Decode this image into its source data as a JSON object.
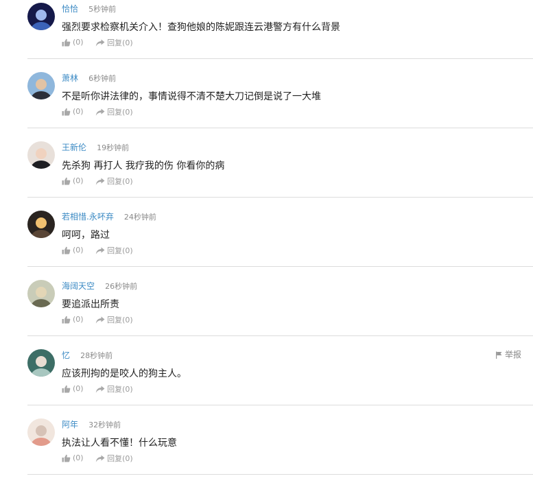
{
  "comments": [
    {
      "username": "恰恰",
      "time": "5秒钟前",
      "content": "强烈要求检察机关介入！查狗他娘的陈妮跟连云港警方有什么背景",
      "like_count": "(0)",
      "reply_label": "回复",
      "reply_count": "(0)",
      "avatar_colors": [
        "#15194a",
        "#3c63b8",
        "#9fb8ee"
      ]
    },
    {
      "username": "萧林",
      "time": "6秒钟前",
      "content": "不是听你讲法律的，事情说得不清不楚大刀记倒是说了一大堆",
      "like_count": "(0)",
      "reply_label": "回复",
      "reply_count": "(0)",
      "avatar_colors": [
        "#8fb7dc",
        "#2b2f3a",
        "#e2c3a4"
      ]
    },
    {
      "username": "王新伦",
      "time": "19秒钟前",
      "content": "先杀狗 再打人 我疗我的伤 你看你的病",
      "like_count": "(0)",
      "reply_label": "回复",
      "reply_count": "(0)",
      "avatar_colors": [
        "#e8e0da",
        "#1e1e22",
        "#f0d2bf"
      ]
    },
    {
      "username": "若相惜.永吥弃",
      "time": "24秒钟前",
      "content": "呵呵，路过",
      "like_count": "(0)",
      "reply_label": "回复",
      "reply_count": "(0)",
      "avatar_colors": [
        "#2a2420",
        "#5a4636",
        "#f0c070"
      ]
    },
    {
      "username": "海阔天空",
      "time": "26秒钟前",
      "content": "要追派出所责",
      "like_count": "(0)",
      "reply_label": "回复",
      "reply_count": "(0)",
      "avatar_colors": [
        "#c9ccb8",
        "#6a6a52",
        "#e3d6b6"
      ]
    },
    {
      "username": "忆",
      "time": "28秒钟前",
      "content": "应该刑拘的是咬人的狗主人。",
      "like_count": "(0)",
      "reply_label": "回复",
      "reply_count": "(0)",
      "avatar_colors": [
        "#3d6e66",
        "#a8c7c0",
        "#e9ddd2"
      ],
      "report_label": "举报"
    },
    {
      "username": "阿年",
      "time": "32秒钟前",
      "content": "执法让人看不懂！什么玩意",
      "like_count": "(0)",
      "reply_label": "回复",
      "reply_count": "(0)",
      "avatar_colors": [
        "#f1e6de",
        "#e29b8b",
        "#d6c2b6"
      ]
    }
  ]
}
